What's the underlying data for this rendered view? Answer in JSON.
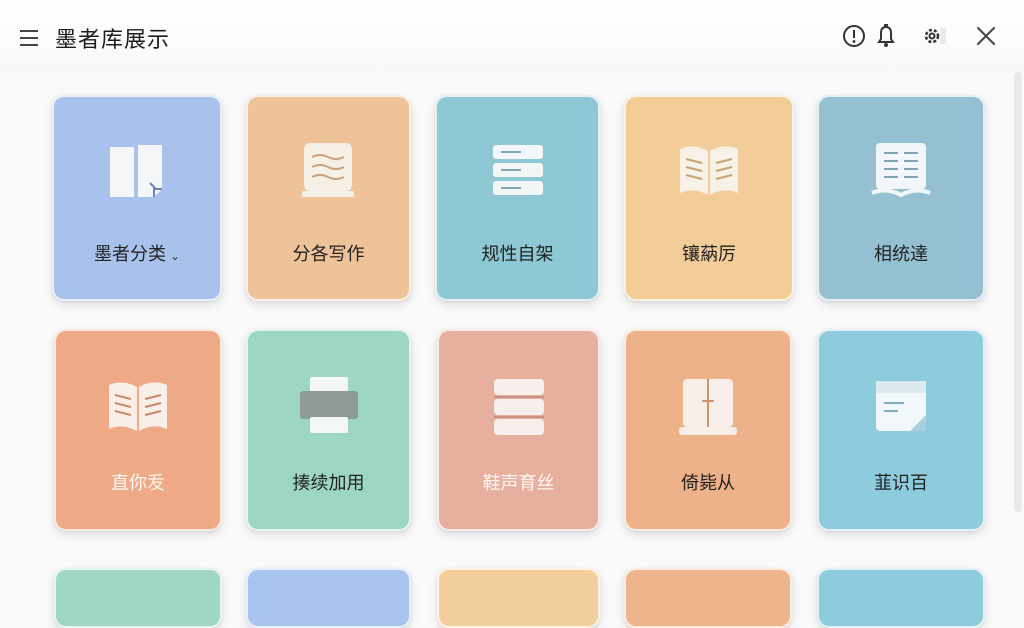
{
  "header": {
    "title": "墨者库展示",
    "icons": [
      "menu-icon",
      "info-icon",
      "bell-icon",
      "settings-icon",
      "close-icon"
    ]
  },
  "tiles_row1": [
    {
      "label": "墨者分类",
      "color": "#a9c2ec",
      "icon": "open-book-page-icon",
      "has_dropdown": true,
      "dropdown_glyph": "⌄"
    },
    {
      "label": "分各写作",
      "color": "#eec39a",
      "icon": "scroll-book-icon"
    },
    {
      "label": "规性自架",
      "color": "#8ec8d4",
      "icon": "stacked-books-icon"
    },
    {
      "label": "镶蒳厉",
      "color": "#f2cd98",
      "icon": "open-book-icon"
    },
    {
      "label": "相统達",
      "color": "#94c0d2",
      "icon": "open-book-lines-icon"
    }
  ],
  "tiles_row2": [
    {
      "label": "直你叐",
      "color": "#eea987",
      "icon": "open-book-icon"
    },
    {
      "label": "揍续加用",
      "color": "#9ed6c6",
      "icon": "printer-icon"
    },
    {
      "label": "鞋声育丝",
      "color": "#e7b09e",
      "icon": "stacked-books-icon"
    },
    {
      "label": "倚毙从",
      "color": "#edb28a",
      "icon": "bookmark-book-icon"
    },
    {
      "label": "韮识百",
      "color": "#8ecbdc",
      "icon": "document-page-icon"
    }
  ],
  "tiles_row3_colors": [
    "#9fd7c4",
    "#a9c4ee",
    "#f2cf9c",
    "#eeb58d",
    "#8ecbdc"
  ]
}
